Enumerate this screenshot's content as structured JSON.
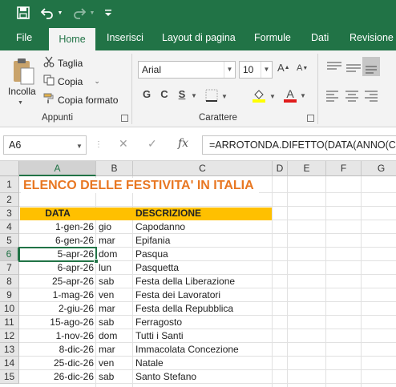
{
  "quick_access": {
    "save_icon": "save-icon",
    "undo_icon": "undo-icon",
    "redo_icon": "redo-icon",
    "customize_icon": "customize-icon"
  },
  "ribbon_tabs": [
    "File",
    "Home",
    "Inserisci",
    "Layout di pagina",
    "Formule",
    "Dati",
    "Revisione"
  ],
  "clipboard": {
    "paste_label": "Incolla",
    "cut_label": "Taglia",
    "copy_label": "Copia",
    "format_painter_label": "Copia formato",
    "group_label": "Appunti"
  },
  "font": {
    "family": "Arial",
    "size": "10",
    "bold": "G",
    "italic": "C",
    "underline": "S",
    "group_label": "Carattere"
  },
  "formula_bar": {
    "name_box": "A6",
    "fx_label": "fx",
    "formula": "=ARROTONDA.DIFETTO(DATA(ANNO(C"
  },
  "columns": [
    "A",
    "B",
    "C",
    "D",
    "E",
    "F",
    "G"
  ],
  "rows": [
    "1",
    "2",
    "3",
    "4",
    "5",
    "6",
    "7",
    "8",
    "9",
    "10",
    "11",
    "12",
    "13",
    "14",
    "15"
  ],
  "sheet": {
    "title": "ELENCO DELLE FESTIVITA' IN ITALIA",
    "header": {
      "date": "DATA",
      "description": "DESCRIZIONE"
    },
    "entries": [
      {
        "date": "1-gen-26",
        "day": "gio",
        "description": "Capodanno"
      },
      {
        "date": "6-gen-26",
        "day": "mar",
        "description": "Epifania"
      },
      {
        "date": "5-apr-26",
        "day": "dom",
        "description": "Pasqua"
      },
      {
        "date": "6-apr-26",
        "day": "lun",
        "description": "Pasquetta"
      },
      {
        "date": "25-apr-26",
        "day": "sab",
        "description": "Festa della Liberazione"
      },
      {
        "date": "1-mag-26",
        "day": "ven",
        "description": "Festa dei Lavoratori"
      },
      {
        "date": "2-giu-26",
        "day": "mar",
        "description": "Festa della Repubblica"
      },
      {
        "date": "15-ago-26",
        "day": "sab",
        "description": "Ferragosto"
      },
      {
        "date": "1-nov-26",
        "day": "dom",
        "description": "Tutti i Santi"
      },
      {
        "date": "8-dic-26",
        "day": "mar",
        "description": "Immacolata Concezione"
      },
      {
        "date": "25-dic-26",
        "day": "ven",
        "description": "Natale"
      },
      {
        "date": "26-dic-26",
        "day": "sab",
        "description": "Santo Stefano"
      }
    ]
  },
  "colors": {
    "accent": "#217346",
    "title": "#e87722",
    "header_fill": "#ffc000"
  }
}
